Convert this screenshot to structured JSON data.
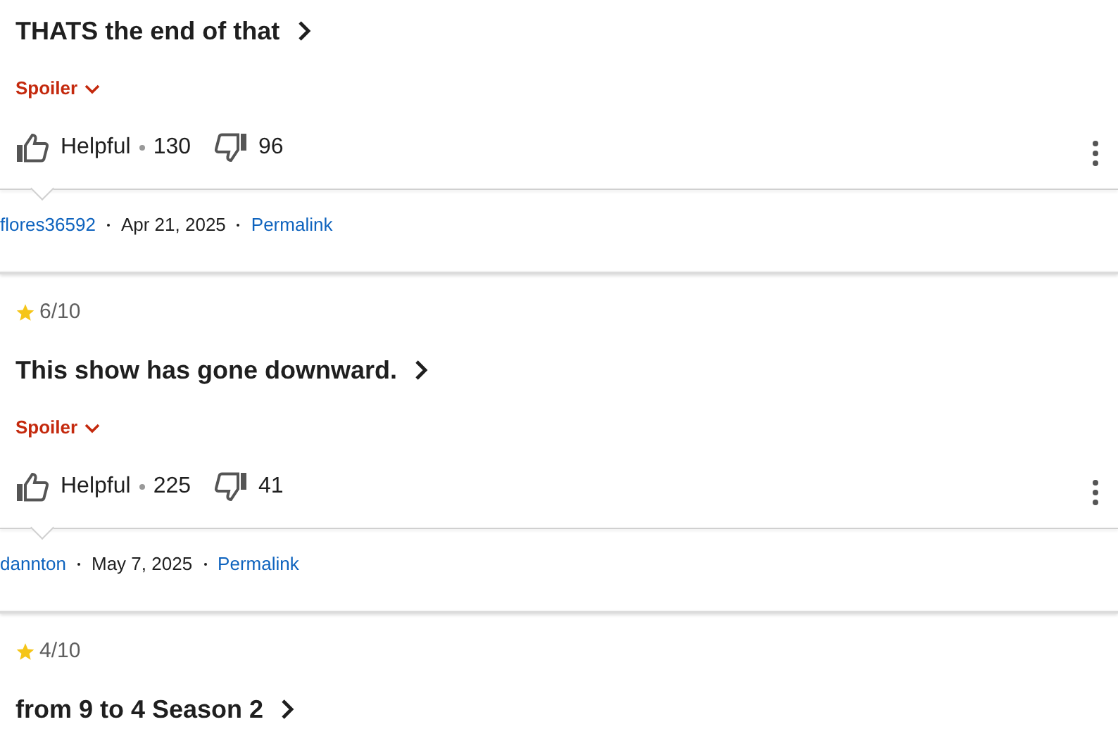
{
  "reviews": [
    {
      "title": "THATS the end of that",
      "spoiler": "Spoiler",
      "helpful_label": "Helpful",
      "helpful_count": "130",
      "unhelpful_count": "96",
      "author": "flores36592",
      "date": "Apr 21, 2025",
      "permalink": "Permalink"
    },
    {
      "rating": "6/10",
      "title": "This show has gone downward.",
      "spoiler": "Spoiler",
      "helpful_label": "Helpful",
      "helpful_count": "225",
      "unhelpful_count": "41",
      "author": "dannton",
      "date": "May 7, 2025",
      "permalink": "Permalink"
    },
    {
      "rating": "4/10",
      "title": "from 9 to 4 Season 2"
    }
  ]
}
